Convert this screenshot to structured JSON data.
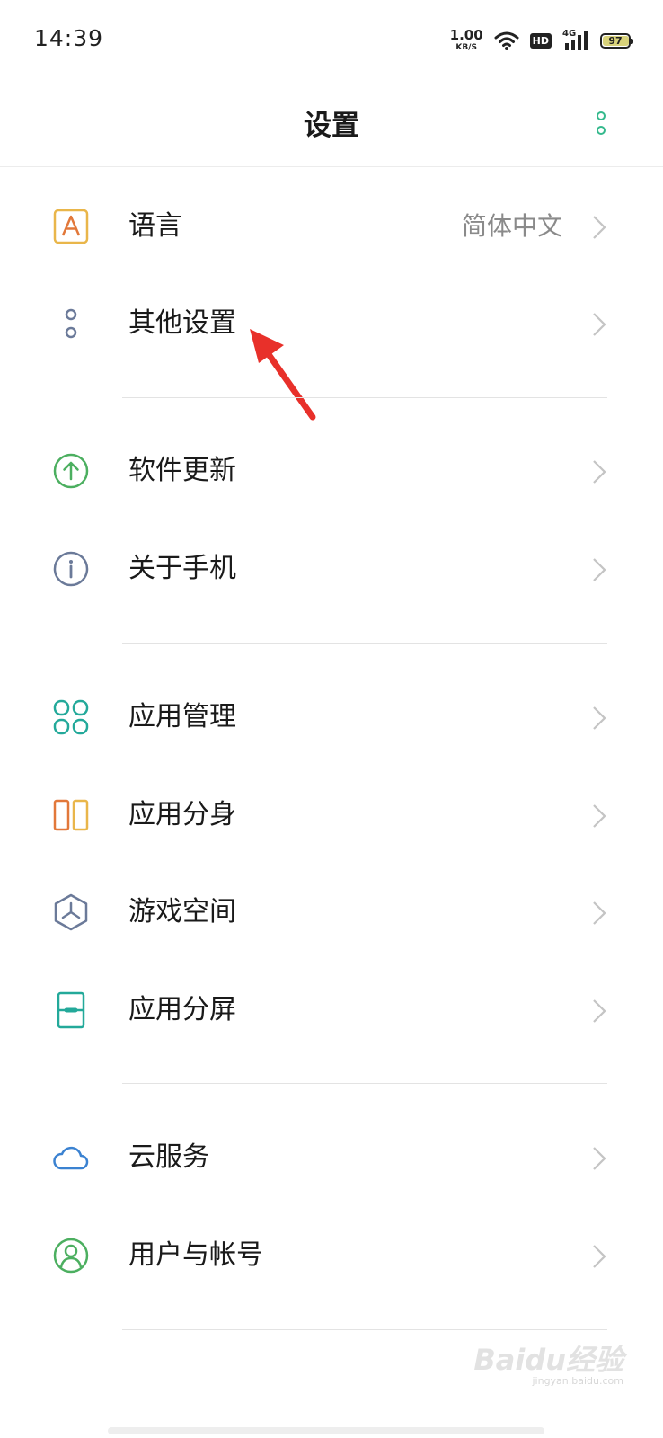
{
  "status_bar": {
    "time": "14:39",
    "net_speed_value": "1.00",
    "net_speed_unit": "KB/S",
    "hd_label": "HD",
    "signal_label": "4G",
    "battery_level": "97",
    "icons": [
      "wifi-icon",
      "hd-icon",
      "signal-icon",
      "battery-icon"
    ]
  },
  "header": {
    "title": "设置",
    "more_icon": "more-vertical-icon",
    "accent_color": "#35b98d"
  },
  "settings": {
    "language": {
      "label": "语言",
      "value": "简体中文",
      "icon": "language-icon",
      "color": "#e2783a"
    },
    "other": {
      "label": "其他设置",
      "icon": "more-options-icon",
      "color": "#6b7a99"
    },
    "update": {
      "label": "软件更新",
      "icon": "update-icon",
      "color": "#4caf60"
    },
    "about": {
      "label": "关于手机",
      "icon": "info-icon",
      "color": "#6b7a99"
    },
    "apps": {
      "label": "应用管理",
      "icon": "app-management-icon",
      "color": "#23a99a"
    },
    "clone": {
      "label": "应用分身",
      "icon": "app-clone-icon",
      "color": "#e2783a"
    },
    "game": {
      "label": "游戏空间",
      "icon": "game-space-icon",
      "color": "#6b7a99"
    },
    "split": {
      "label": "应用分屏",
      "icon": "split-screen-icon",
      "color": "#23a99a"
    },
    "cloud": {
      "label": "云服务",
      "icon": "cloud-icon",
      "color": "#3b82d1"
    },
    "account": {
      "label": "用户与帐号",
      "icon": "user-account-icon",
      "color": "#4caf60"
    }
  },
  "annotation": {
    "arrow_color": "#e8302a"
  },
  "watermark": {
    "main": "Baidu经验",
    "sub": "jingyan.baidu.com"
  }
}
